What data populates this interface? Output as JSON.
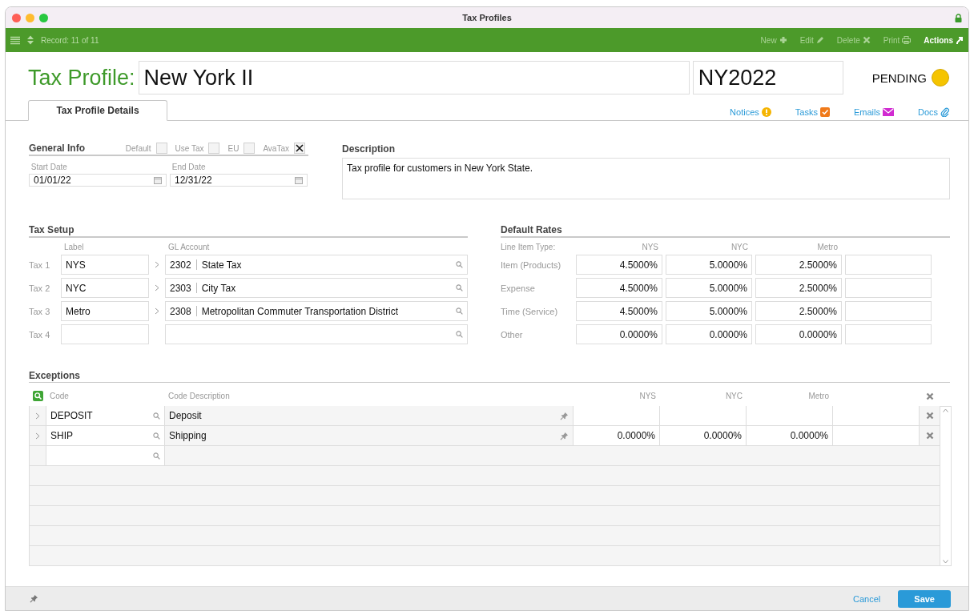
{
  "window": {
    "title": "Tax Profiles"
  },
  "toolbar": {
    "record": "Record: 11 of 11",
    "actions": [
      {
        "label": "New",
        "kind": "new",
        "disabled": true
      },
      {
        "label": "Edit",
        "kind": "edit",
        "disabled": true
      },
      {
        "label": "Delete",
        "kind": "delete",
        "disabled": true
      },
      {
        "label": "Print",
        "kind": "print",
        "disabled": true
      },
      {
        "label": "Actions",
        "kind": "actions",
        "disabled": false
      }
    ]
  },
  "header": {
    "label": "Tax Profile:",
    "name": "New York II",
    "code": "NY2022",
    "status": "PENDING"
  },
  "tabs": [
    {
      "label": "Tax Profile Details",
      "selected": true
    }
  ],
  "links": [
    {
      "label": "Notices",
      "kind": "notices"
    },
    {
      "label": "Tasks",
      "kind": "tasks"
    },
    {
      "label": "Emails",
      "kind": "emails"
    },
    {
      "label": "Docs",
      "kind": "docs"
    }
  ],
  "general_info": {
    "title": "General Info",
    "flags": [
      {
        "label": "Default",
        "checked": false
      },
      {
        "label": "Use Tax",
        "checked": false
      },
      {
        "label": "EU",
        "checked": false
      },
      {
        "label": "AvaTax",
        "checked": true
      }
    ],
    "start_date": {
      "label": "Start Date",
      "value": "01/01/22"
    },
    "end_date": {
      "label": "End Date",
      "value": "12/31/22"
    }
  },
  "description": {
    "title": "Description",
    "value": "Tax profile for customers in New York State."
  },
  "tax_setup": {
    "title": "Tax Setup",
    "columns": [
      "Label",
      "GL Account"
    ],
    "rows": [
      {
        "name": "Tax 1",
        "label": "NYS",
        "account": "2302",
        "account_name": "State Tax"
      },
      {
        "name": "Tax 2",
        "label": "NYC",
        "account": "2303",
        "account_name": "City Tax"
      },
      {
        "name": "Tax 3",
        "label": "Metro",
        "account": "2308",
        "account_name": "Metropolitan Commuter Transportation District"
      },
      {
        "name": "Tax 4"
      }
    ]
  },
  "default_rates": {
    "title": "Default Rates",
    "columns": [
      "Line Item Type:",
      "NYS",
      "NYC",
      "Metro"
    ],
    "rows": [
      {
        "type": "Item (Products)",
        "values": [
          "4.5000%",
          "5.0000%",
          "2.5000%"
        ]
      },
      {
        "type": "Expense",
        "values": [
          "4.5000%",
          "5.0000%",
          "2.5000%"
        ]
      },
      {
        "type": "Time (Service)",
        "values": [
          "4.5000%",
          "5.0000%",
          "2.5000%"
        ]
      },
      {
        "type": "Other",
        "values": [
          "0.0000%",
          "0.0000%",
          "0.0000%"
        ]
      }
    ]
  },
  "exceptions": {
    "title": "Exceptions",
    "columns": [
      "Code",
      "Code Description",
      "NYS",
      "NYC",
      "Metro"
    ],
    "rows": [
      {
        "code": "DEPOSIT",
        "description": "Deposit",
        "values": []
      },
      {
        "code": "SHIP",
        "description": "Shipping",
        "values": [
          "0.0000%",
          "0.0000%",
          "0.0000%"
        ]
      }
    ]
  },
  "footer": {
    "buttons": [
      {
        "label": "Cancel",
        "kind": "link"
      },
      {
        "label": "Save",
        "kind": "primary"
      }
    ]
  }
}
